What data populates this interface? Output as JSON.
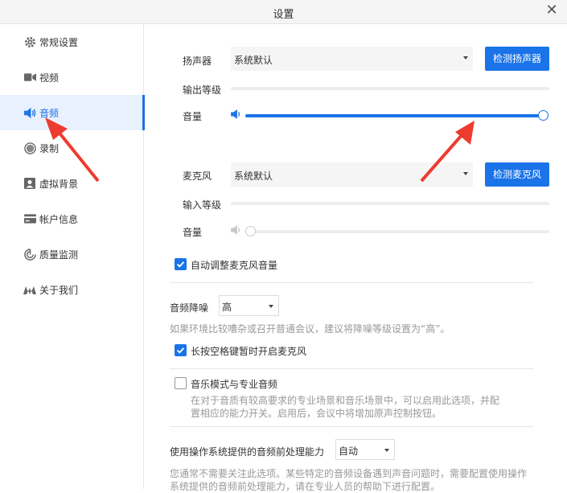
{
  "window": {
    "title": "设置",
    "close_icon": "close-icon"
  },
  "sidebar": {
    "items": [
      {
        "label": "常规设置",
        "icon": "gear-icon"
      },
      {
        "label": "视频",
        "icon": "video-camera-icon"
      },
      {
        "label": "音频",
        "icon": "speaker-icon",
        "active": true
      },
      {
        "label": "录制",
        "icon": "record-icon"
      },
      {
        "label": "虚拟背景",
        "icon": "virtual-background-icon"
      },
      {
        "label": "帐户信息",
        "icon": "account-card-icon"
      },
      {
        "label": "质量监测",
        "icon": "monitor-icon"
      },
      {
        "label": "关于我们",
        "icon": "logo-icon"
      }
    ]
  },
  "speaker": {
    "label": "扬声器",
    "device": "系统默认",
    "test_button": "检测扬声器",
    "output_level_label": "输出等级",
    "volume_label": "音量",
    "volume": 1.0
  },
  "mic": {
    "label": "麦克风",
    "device": "系统默认",
    "test_button": "检测麦克风",
    "input_level_label": "输入等级",
    "volume_label": "音量",
    "volume": 0.0
  },
  "options": {
    "auto_adjust_label": "自动调整麦克风音量",
    "auto_adjust": true,
    "noise_label": "音频降噪",
    "noise_value": "高",
    "noise_hint": "如果环境比较嘈杂或召开普通会议，建议将降噪等级设置为“高”。",
    "space_unmute_label": "长按空格键暂时开启麦克风",
    "space_unmute": true,
    "music_mode_label": "音乐模式与专业音频",
    "music_mode": false,
    "music_mode_hint_1": "在对于音质有较高要求的专业场景和音乐场景中，可以启用此选项，并配",
    "music_mode_hint_2": "置相应的能力开关。启用后，会议中将增加原声控制按钮。",
    "os_processing_label": "使用操作系统提供的音频前处理能力",
    "os_processing_value": "自动",
    "os_hint_1": "您通常不需要关注此选项。某些特定的音频设备遇到声音问题时，需要配置使用操作",
    "os_hint_2": "系统提供的音频前处理能力，请在专业人员的帮助下进行配置。"
  },
  "colors": {
    "accent": "#1a73e8",
    "arrow": "#ee3b30"
  }
}
